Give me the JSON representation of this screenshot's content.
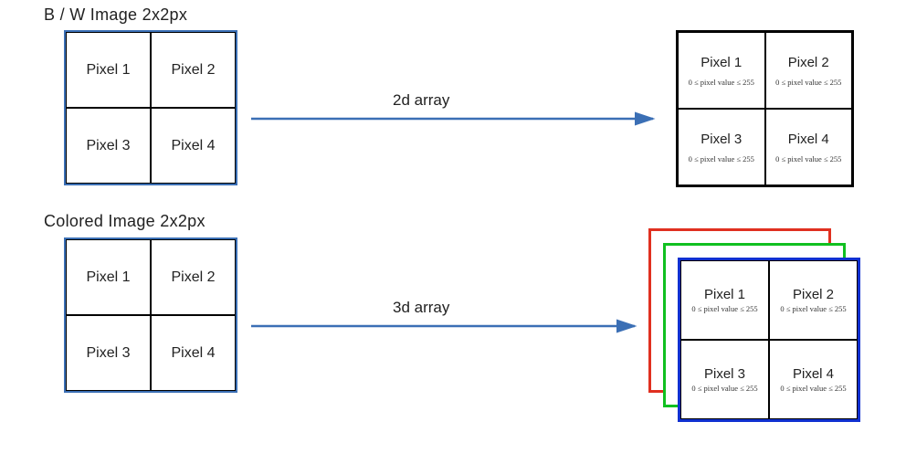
{
  "titles": {
    "bw": "B / W Image 2x2px",
    "color": "Colored Image 2x2px"
  },
  "arrows": {
    "top_label": "2d array",
    "bottom_label": "3d array"
  },
  "pixels": {
    "p1": "Pixel 1",
    "p2": "Pixel 2",
    "p3": "Pixel 3",
    "p4": "Pixel 4"
  },
  "constraint": "0 ≤ pixel value ≤ 255",
  "colors": {
    "source_border": "#3b6fb5",
    "arrow": "#3b6fb5",
    "bw_border": "#000000",
    "stack_back": "#e03020",
    "stack_mid": "#10c020",
    "stack_front": "#1030d0"
  }
}
